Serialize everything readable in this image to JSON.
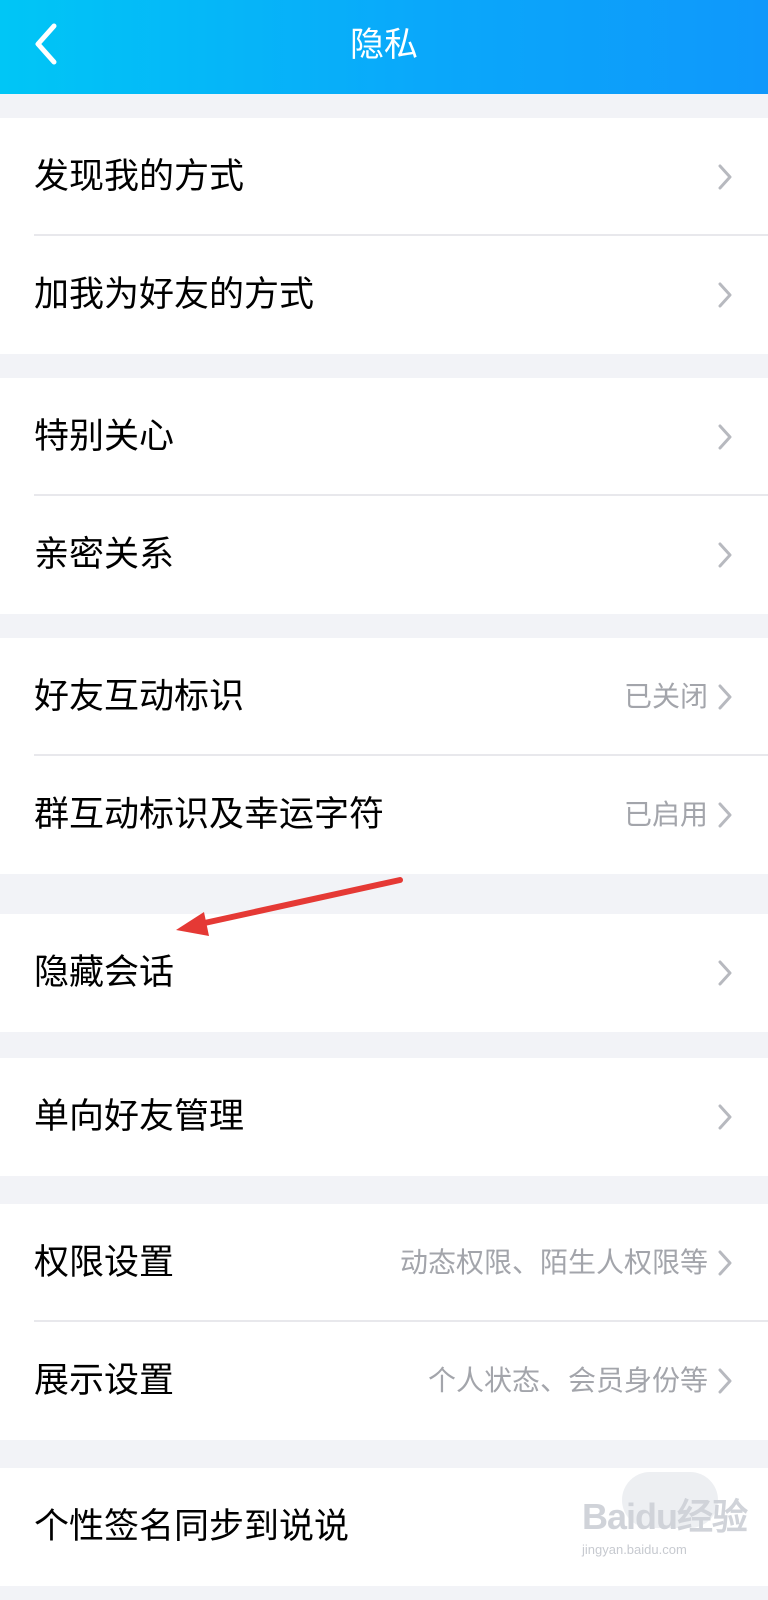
{
  "header": {
    "title": "隐私",
    "back_icon": "chevron-left-icon"
  },
  "groups": [
    {
      "items": [
        {
          "label": "发现我的方式",
          "value": ""
        },
        {
          "label": "加我为好友的方式",
          "value": ""
        }
      ]
    },
    {
      "items": [
        {
          "label": "特别关心",
          "value": ""
        },
        {
          "label": "亲密关系",
          "value": ""
        }
      ]
    },
    {
      "items": [
        {
          "label": "好友互动标识",
          "value": "已关闭"
        },
        {
          "label": "群互动标识及幸运字符",
          "value": "已启用"
        }
      ]
    },
    {
      "items": [
        {
          "label": "隐藏会话",
          "value": ""
        }
      ]
    },
    {
      "items": [
        {
          "label": "单向好友管理",
          "value": ""
        }
      ]
    },
    {
      "items": [
        {
          "label": "权限设置",
          "value": "动态权限、陌生人权限等"
        },
        {
          "label": "展示设置",
          "value": "个人状态、会员身份等"
        }
      ]
    },
    {
      "items": [
        {
          "label": "个性签名同步到说说",
          "value": ""
        }
      ]
    }
  ],
  "watermark": {
    "text": "Baidu经验",
    "sub": "jingyan.baidu.com"
  },
  "colors": {
    "header_gradient_start": "#00c6f6",
    "header_gradient_end": "#0f98fb",
    "background": "#f2f3f7",
    "value_text": "#a3a5ab",
    "annotation_arrow": "#e53935"
  }
}
